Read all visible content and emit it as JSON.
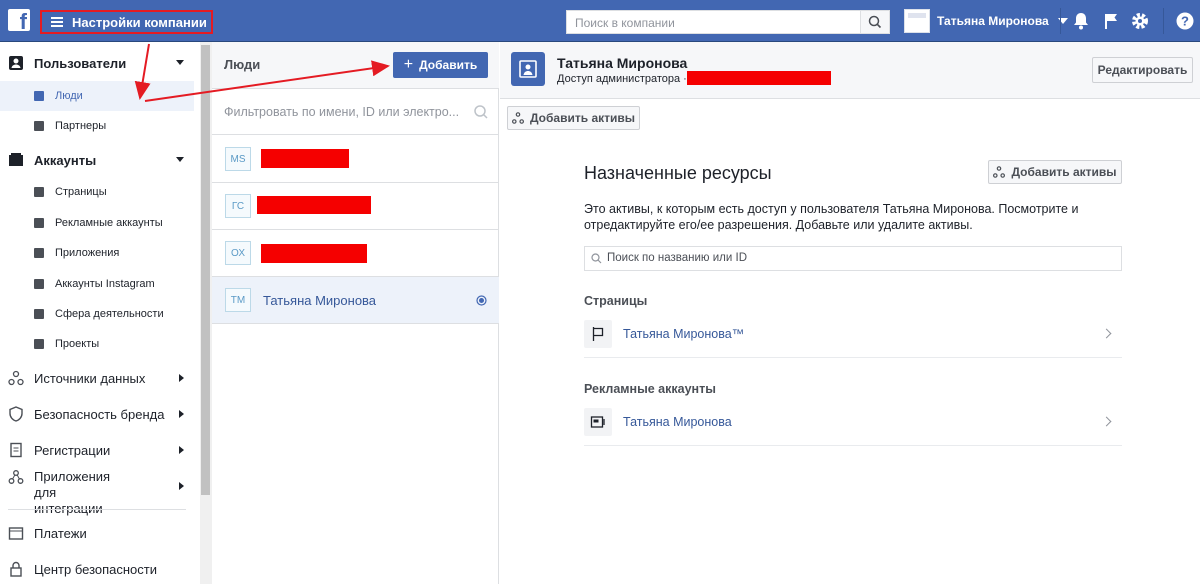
{
  "topbar": {
    "logo": "f",
    "menu_label": "Настройки компании",
    "search_placeholder": "Поиск в компании",
    "user_name": "Татьяна Миронова"
  },
  "sidebar": {
    "users_section": "Пользователи",
    "users_items": [
      "Люди",
      "Партнеры"
    ],
    "accounts_section": "Аккаунты",
    "accounts_items": [
      "Страницы",
      "Рекламные аккаунты",
      "Приложения",
      "Аккаунты Instagram",
      "Сфера деятельности",
      "Проекты"
    ],
    "data_sources": "Источники данных",
    "brand_safety": "Безопасность бренда",
    "registrations": "Регистрации",
    "integrations": "Приложения для интеграции",
    "payments": "Платежи",
    "security_center": "Центр безопасности"
  },
  "people_panel": {
    "title": "Люди",
    "add_label": "Добавить",
    "filter_placeholder": "Фильтровать по имени, ID или электро...",
    "people": [
      {
        "initials": "MS",
        "name": ""
      },
      {
        "initials": "ГС",
        "name": ""
      },
      {
        "initials": "ОХ",
        "name": ""
      },
      {
        "initials": "ТМ",
        "name": "Татьяна Миронова"
      }
    ]
  },
  "detail": {
    "name": "Татьяна Миронова",
    "access": "Доступ администратора ·",
    "edit_label": "Редактировать",
    "add_assets_label": "Добавить активы",
    "resources_title": "Назначенные ресурсы",
    "resources_desc": "Это активы, к которым есть доступ у пользователя Татьяна Миронова. Посмотрите и отредактируйте его/ее разрешения. Добавьте или удалите активы.",
    "search_placeholder": "Поиск по названию или ID",
    "pages_group": "Страницы",
    "page_asset": "Татьяна Миронова™",
    "ad_group": "Рекламные аккаунты",
    "ad_asset": "Татьяна Миронова"
  },
  "colors": {
    "brand": "#4267b2",
    "annotation": "#e41b23",
    "redaction": "#f50000"
  }
}
